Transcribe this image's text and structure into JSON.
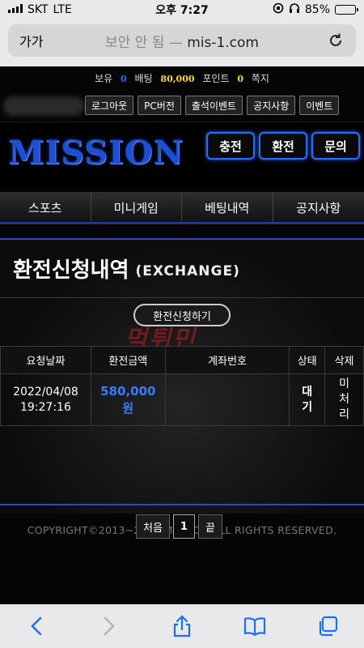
{
  "status_bar": {
    "carrier": "SKT",
    "network": "LTE",
    "time": "오후 7:27",
    "battery": "85%",
    "battery_level": 0.85
  },
  "browser": {
    "text_size": "가가",
    "insecure_label": "보안 안 됨",
    "separator": "—",
    "domain": "mis-1.com"
  },
  "info": {
    "balance_label": "보유",
    "balance_value": "0",
    "bet_label": "배팅",
    "bet_value": "80,000",
    "point_label": "포인트",
    "point_value": "0",
    "message_label": "쪽지"
  },
  "top_buttons": [
    "로그아웃",
    "PC버전",
    "출석이벤트",
    "공지사항",
    "이벤트"
  ],
  "logo": "MISSION",
  "cta": {
    "charge": "충전",
    "exchange": "환전",
    "inquiry": "문의"
  },
  "nav": [
    "스포츠",
    "미니게임",
    "베팅내역",
    "공지사항"
  ],
  "page": {
    "title": "환전신청내역",
    "subtitle": "(EXCHANGE)",
    "request_button": "환전신청하기",
    "watermark": "먹튀민"
  },
  "table": {
    "headers": [
      "요청날짜",
      "환전금액",
      "계좌번호",
      "상태",
      "삭제"
    ],
    "rows": [
      {
        "date": "2022/04/08",
        "time": "19:27:16",
        "amount": "580,000",
        "unit": "원",
        "account": "",
        "status": "대기",
        "delete": "미처리"
      }
    ]
  },
  "pager": {
    "first": "처음",
    "current": "1",
    "last": "끝"
  },
  "footer": {
    "copyright": "COPYRIGHT©2013~2021 MISSION ALL RIGHTS RESERVED."
  },
  "colors": {
    "accent_blue": "#2a6cff",
    "logo_blue": "#1a4fd6",
    "point_yellow": "#ffd92a"
  }
}
